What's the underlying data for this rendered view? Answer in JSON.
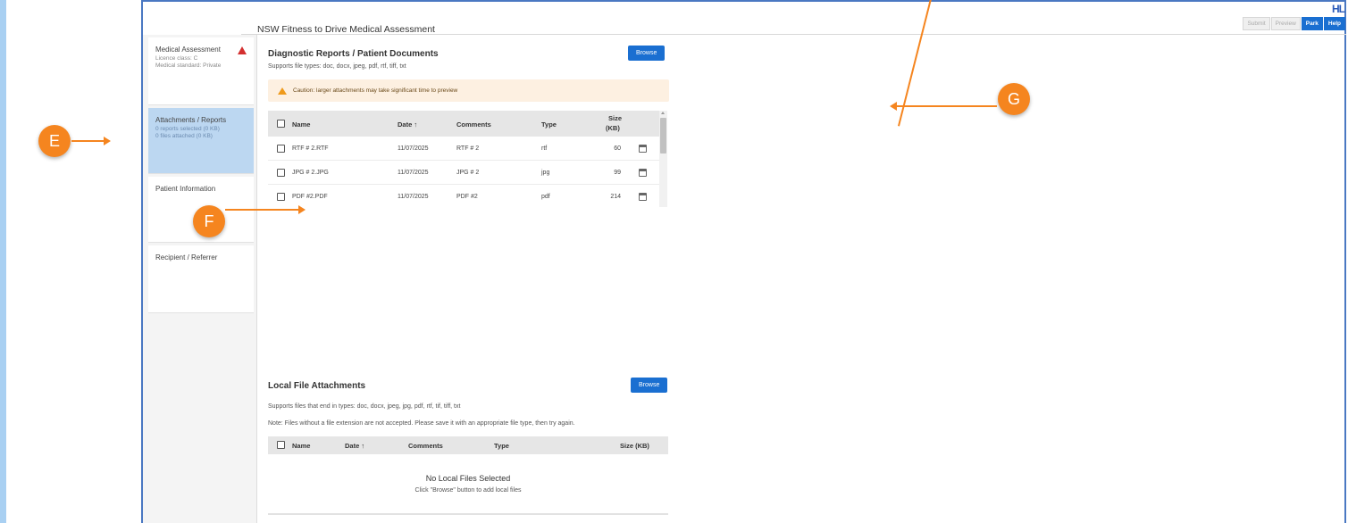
{
  "app": {
    "title": "NSW Fitness to Drive Medical Assessment",
    "logo": "HL"
  },
  "top_actions": [
    {
      "label": "Submit",
      "enabled": false
    },
    {
      "label": "Preview",
      "enabled": false
    },
    {
      "label": "Park",
      "enabled": true
    },
    {
      "label": "Help",
      "enabled": true
    }
  ],
  "sidebar": {
    "items": [
      {
        "label": "Medical Assessment",
        "sub1": "Licence class: C",
        "sub2": "Medical standard: Private",
        "warning": true,
        "active": false
      },
      {
        "label": "Attachments / Reports",
        "sub1": "0 reports selected (0 KB)",
        "sub2": "0 files attached (0 KB)",
        "warning": false,
        "active": true
      },
      {
        "label": "Patient Information",
        "warning": false,
        "active": false
      },
      {
        "label": "Recipient / Referrer",
        "warning": false,
        "active": false
      }
    ]
  },
  "diagnostic": {
    "title": "Diagnostic Reports / Patient Documents",
    "subtitle": "Supports file types: doc, docx, jpeg, pdf, rtf, tiff, txt",
    "browse_label": "Browse",
    "caution": "Caution: larger attachments may take significant time to preview",
    "columns": {
      "name": "Name",
      "date": "Date ↑",
      "comments": "Comments",
      "type": "Type",
      "size_line1": "Size",
      "size_line2": "(KB)"
    },
    "rows": [
      {
        "name": "RTF # 2.RTF",
        "date": "11/07/2025",
        "comments": "RTF # 2",
        "type": "rtf",
        "size": "60"
      },
      {
        "name": "JPG # 2.JPG",
        "date": "11/07/2025",
        "comments": "JPG # 2",
        "type": "jpg",
        "size": "99"
      },
      {
        "name": "PDF #2.PDF",
        "date": "11/07/2025",
        "comments": "PDF #2",
        "type": "pdf",
        "size": "214"
      }
    ]
  },
  "local": {
    "title": "Local File Attachments",
    "browse_label": "Browse",
    "subtitle": "Supports files that end in types: doc, docx, jpeg, jpg, pdf, rtf, tif, tiff, txt",
    "note": "Note: Files without a file extension are not accepted. Please save it with an appropriate file type, then try again.",
    "columns": {
      "name": "Name",
      "date": "Date ↑",
      "comments": "Comments",
      "type": "Type",
      "size": "Size (KB)"
    },
    "empty_title": "No Local Files Selected",
    "empty_sub": "Click \"Browse\" button to add local files"
  },
  "annotations": {
    "e": "E",
    "f": "F",
    "g": "G",
    "color": "#f5851f"
  }
}
